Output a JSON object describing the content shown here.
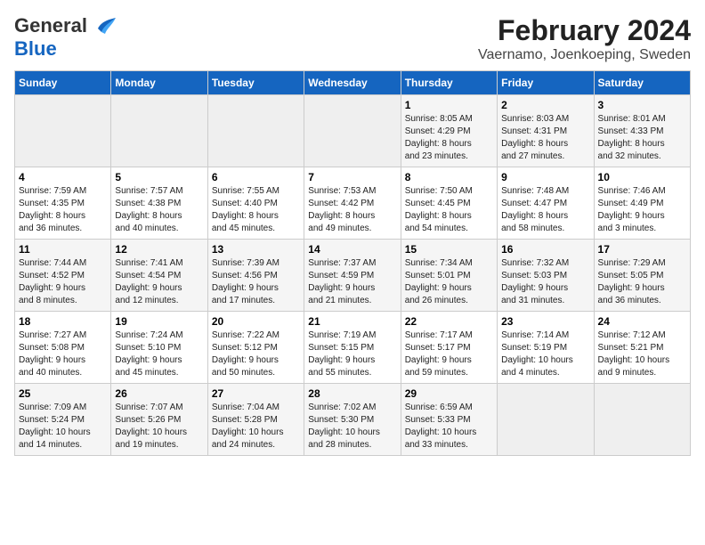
{
  "header": {
    "logo_general": "General",
    "logo_blue": "Blue",
    "title": "February 2024",
    "subtitle": "Vaernamo, Joenkoeping, Sweden"
  },
  "days_of_week": [
    "Sunday",
    "Monday",
    "Tuesday",
    "Wednesday",
    "Thursday",
    "Friday",
    "Saturday"
  ],
  "weeks": [
    [
      {
        "day": "",
        "info": ""
      },
      {
        "day": "",
        "info": ""
      },
      {
        "day": "",
        "info": ""
      },
      {
        "day": "",
        "info": ""
      },
      {
        "day": "1",
        "info": "Sunrise: 8:05 AM\nSunset: 4:29 PM\nDaylight: 8 hours\nand 23 minutes."
      },
      {
        "day": "2",
        "info": "Sunrise: 8:03 AM\nSunset: 4:31 PM\nDaylight: 8 hours\nand 27 minutes."
      },
      {
        "day": "3",
        "info": "Sunrise: 8:01 AM\nSunset: 4:33 PM\nDaylight: 8 hours\nand 32 minutes."
      }
    ],
    [
      {
        "day": "4",
        "info": "Sunrise: 7:59 AM\nSunset: 4:35 PM\nDaylight: 8 hours\nand 36 minutes."
      },
      {
        "day": "5",
        "info": "Sunrise: 7:57 AM\nSunset: 4:38 PM\nDaylight: 8 hours\nand 40 minutes."
      },
      {
        "day": "6",
        "info": "Sunrise: 7:55 AM\nSunset: 4:40 PM\nDaylight: 8 hours\nand 45 minutes."
      },
      {
        "day": "7",
        "info": "Sunrise: 7:53 AM\nSunset: 4:42 PM\nDaylight: 8 hours\nand 49 minutes."
      },
      {
        "day": "8",
        "info": "Sunrise: 7:50 AM\nSunset: 4:45 PM\nDaylight: 8 hours\nand 54 minutes."
      },
      {
        "day": "9",
        "info": "Sunrise: 7:48 AM\nSunset: 4:47 PM\nDaylight: 8 hours\nand 58 minutes."
      },
      {
        "day": "10",
        "info": "Sunrise: 7:46 AM\nSunset: 4:49 PM\nDaylight: 9 hours\nand 3 minutes."
      }
    ],
    [
      {
        "day": "11",
        "info": "Sunrise: 7:44 AM\nSunset: 4:52 PM\nDaylight: 9 hours\nand 8 minutes."
      },
      {
        "day": "12",
        "info": "Sunrise: 7:41 AM\nSunset: 4:54 PM\nDaylight: 9 hours\nand 12 minutes."
      },
      {
        "day": "13",
        "info": "Sunrise: 7:39 AM\nSunset: 4:56 PM\nDaylight: 9 hours\nand 17 minutes."
      },
      {
        "day": "14",
        "info": "Sunrise: 7:37 AM\nSunset: 4:59 PM\nDaylight: 9 hours\nand 21 minutes."
      },
      {
        "day": "15",
        "info": "Sunrise: 7:34 AM\nSunset: 5:01 PM\nDaylight: 9 hours\nand 26 minutes."
      },
      {
        "day": "16",
        "info": "Sunrise: 7:32 AM\nSunset: 5:03 PM\nDaylight: 9 hours\nand 31 minutes."
      },
      {
        "day": "17",
        "info": "Sunrise: 7:29 AM\nSunset: 5:05 PM\nDaylight: 9 hours\nand 36 minutes."
      }
    ],
    [
      {
        "day": "18",
        "info": "Sunrise: 7:27 AM\nSunset: 5:08 PM\nDaylight: 9 hours\nand 40 minutes."
      },
      {
        "day": "19",
        "info": "Sunrise: 7:24 AM\nSunset: 5:10 PM\nDaylight: 9 hours\nand 45 minutes."
      },
      {
        "day": "20",
        "info": "Sunrise: 7:22 AM\nSunset: 5:12 PM\nDaylight: 9 hours\nand 50 minutes."
      },
      {
        "day": "21",
        "info": "Sunrise: 7:19 AM\nSunset: 5:15 PM\nDaylight: 9 hours\nand 55 minutes."
      },
      {
        "day": "22",
        "info": "Sunrise: 7:17 AM\nSunset: 5:17 PM\nDaylight: 9 hours\nand 59 minutes."
      },
      {
        "day": "23",
        "info": "Sunrise: 7:14 AM\nSunset: 5:19 PM\nDaylight: 10 hours\nand 4 minutes."
      },
      {
        "day": "24",
        "info": "Sunrise: 7:12 AM\nSunset: 5:21 PM\nDaylight: 10 hours\nand 9 minutes."
      }
    ],
    [
      {
        "day": "25",
        "info": "Sunrise: 7:09 AM\nSunset: 5:24 PM\nDaylight: 10 hours\nand 14 minutes."
      },
      {
        "day": "26",
        "info": "Sunrise: 7:07 AM\nSunset: 5:26 PM\nDaylight: 10 hours\nand 19 minutes."
      },
      {
        "day": "27",
        "info": "Sunrise: 7:04 AM\nSunset: 5:28 PM\nDaylight: 10 hours\nand 24 minutes."
      },
      {
        "day": "28",
        "info": "Sunrise: 7:02 AM\nSunset: 5:30 PM\nDaylight: 10 hours\nand 28 minutes."
      },
      {
        "day": "29",
        "info": "Sunrise: 6:59 AM\nSunset: 5:33 PM\nDaylight: 10 hours\nand 33 minutes."
      },
      {
        "day": "",
        "info": ""
      },
      {
        "day": "",
        "info": ""
      }
    ]
  ]
}
